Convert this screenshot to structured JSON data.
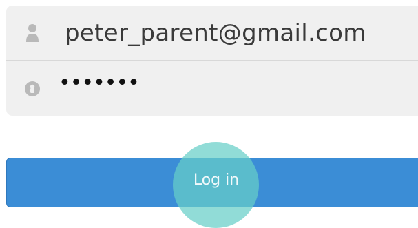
{
  "login_form": {
    "email": {
      "value": "peter_parent@gmail.com",
      "icon": "user-icon"
    },
    "password": {
      "masked_value": "•••••••",
      "icon": "lock-icon"
    },
    "submit": {
      "label": "Log in"
    }
  },
  "colors": {
    "field_background": "#f0f0f0",
    "button_background": "#3b8dd6",
    "touch_indicator": "#66cec8"
  }
}
